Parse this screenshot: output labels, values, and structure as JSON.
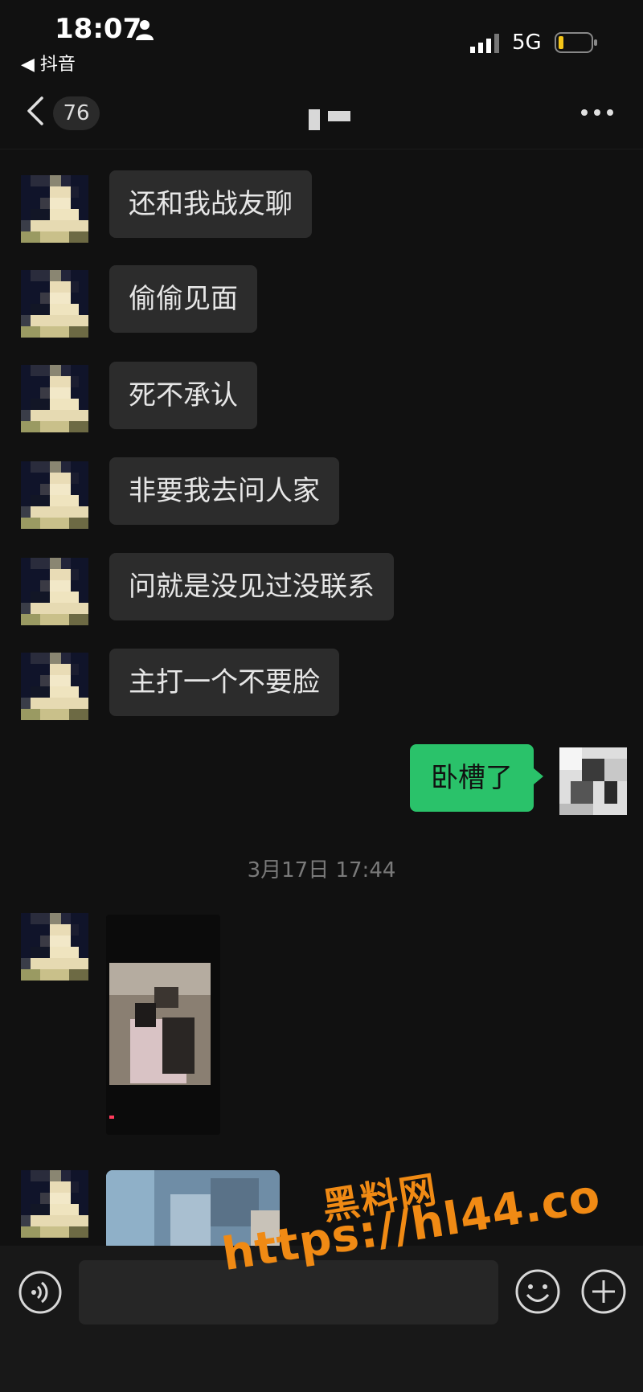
{
  "status_bar": {
    "time": "18:07",
    "back_app": "◀ 抖音",
    "network": "5G"
  },
  "nav": {
    "unread_count": "76",
    "title": ""
  },
  "messages": [
    {
      "text": "还和我战友聊"
    },
    {
      "text": "偷偷见面"
    },
    {
      "text": "死不承认"
    },
    {
      "text": "非要我去问人家"
    },
    {
      "text": "问就是没见过没联系"
    },
    {
      "text": "主打一个不要脸"
    }
  ],
  "sent_message": {
    "text": "卧槽了"
  },
  "timestamp": "3月17日 17:44",
  "input": {
    "placeholder": ""
  },
  "watermark": {
    "line1": "黑料网",
    "line2": "https://hl44.co"
  },
  "colors": {
    "background": "#111111",
    "incoming_bubble": "#2c2c2c",
    "outgoing_bubble": "#2ac26a",
    "watermark": "#f08a14"
  }
}
